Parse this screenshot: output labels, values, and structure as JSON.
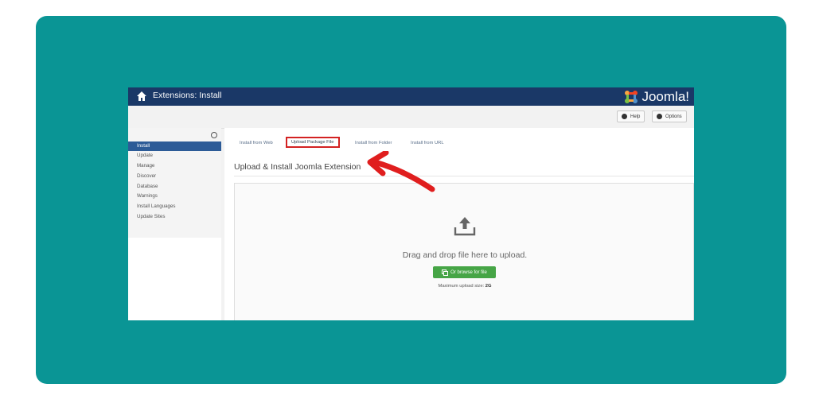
{
  "app": {
    "title": "Extensions: Install",
    "logo_text": "Joomla!"
  },
  "toolbar": {
    "help_label": "Help",
    "options_label": "Options"
  },
  "sidebar": {
    "items": [
      {
        "label": "Install",
        "active": true
      },
      {
        "label": "Update",
        "active": false
      },
      {
        "label": "Manage",
        "active": false
      },
      {
        "label": "Discover",
        "active": false
      },
      {
        "label": "Database",
        "active": false
      },
      {
        "label": "Warnings",
        "active": false
      },
      {
        "label": "Install Languages",
        "active": false
      },
      {
        "label": "Update Sites",
        "active": false
      }
    ]
  },
  "tabs": [
    {
      "label": "Install from Web"
    },
    {
      "label": "Upload Package File",
      "highlighted": true
    },
    {
      "label": "Install from Folder"
    },
    {
      "label": "Install from URL"
    }
  ],
  "main": {
    "heading": "Upload & Install Joomla Extension",
    "drop_text": "Drag and drop file here to upload.",
    "browse_label": "Or browse for file",
    "max_label": "Maximum upload size:",
    "max_value": "2G"
  },
  "colors": {
    "background_card": "#0a9595",
    "topbar": "#1a3867",
    "active_sidebar": "#2c5b97",
    "browse_button": "#46a546",
    "highlight": "#d32222"
  },
  "icons": {
    "home": "home-icon",
    "help": "help-icon",
    "options": "gear-icon",
    "upload": "upload-icon",
    "browse": "copy-icon",
    "annotation": "arrow-annotation-icon"
  }
}
